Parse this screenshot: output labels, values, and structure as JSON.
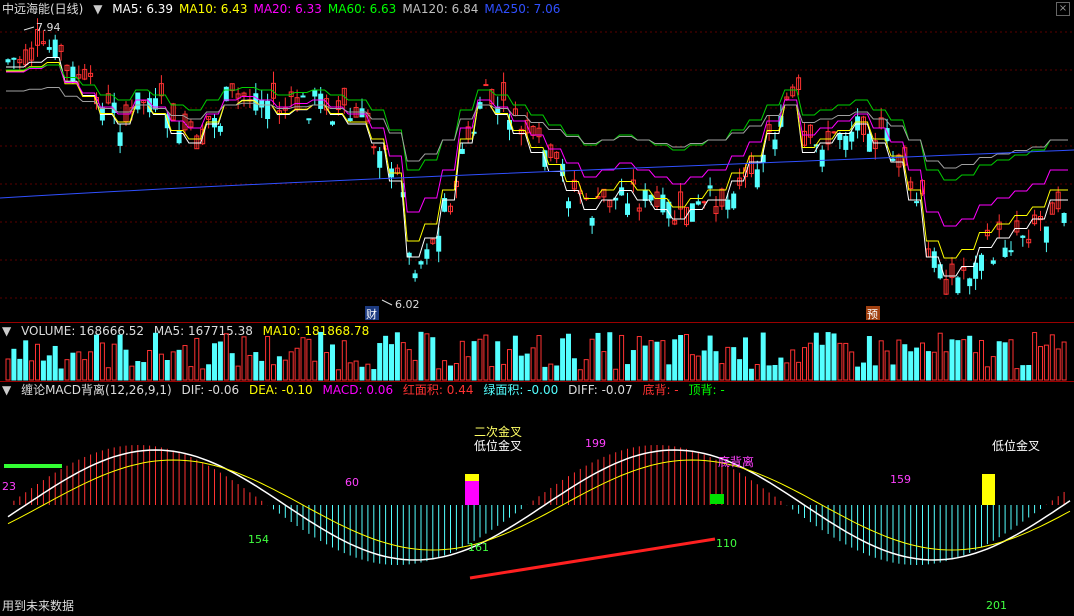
{
  "main": {
    "title": "中远海能(日线)",
    "ma_items": [
      {
        "label": "MA5: 6.39",
        "color": "#ffffff"
      },
      {
        "label": "MA10: 6.43",
        "color": "#ffff00"
      },
      {
        "label": "MA20: 6.33",
        "color": "#ff00ff"
      },
      {
        "label": "MA60: 6.63",
        "color": "#00ff00"
      },
      {
        "label": "MA120: 6.84",
        "color": "#c0c0c0"
      },
      {
        "label": "MA250: 7.06",
        "color": "#3050ff"
      }
    ],
    "high_label": "7.94",
    "low_label": "6.02",
    "marker_cai": "财",
    "marker_yu": "预"
  },
  "volume": {
    "label": "VOLUME: 168666.52",
    "ma5": "MA5: 167715.38",
    "ma10": "MA10: 181868.78"
  },
  "macd": {
    "title": "缠论MACD背离(12,26,9,1)",
    "dif": "DIF: -0.06",
    "dea": "DEA: -0.10",
    "macd": "MACD: 0.06",
    "red_area": "红面积: 0.44",
    "green_area": "绿面积: -0.00",
    "diff": "DIFF: -0.07",
    "bottom_div": "底背: -",
    "top_div": "顶背: -",
    "annotations": {
      "second_cross": "二次金叉",
      "low_cross": "低位金叉",
      "bottom_divergence": "底背离",
      "low_cross_right": "低位金叉"
    },
    "numbers": [
      "23",
      "60",
      "154",
      "161",
      "199",
      "110",
      "159",
      "201"
    ]
  },
  "status": "用到未来数据",
  "colors": {
    "up": "#ff3232",
    "down": "#54ffff",
    "grid": "#7a0000"
  }
}
